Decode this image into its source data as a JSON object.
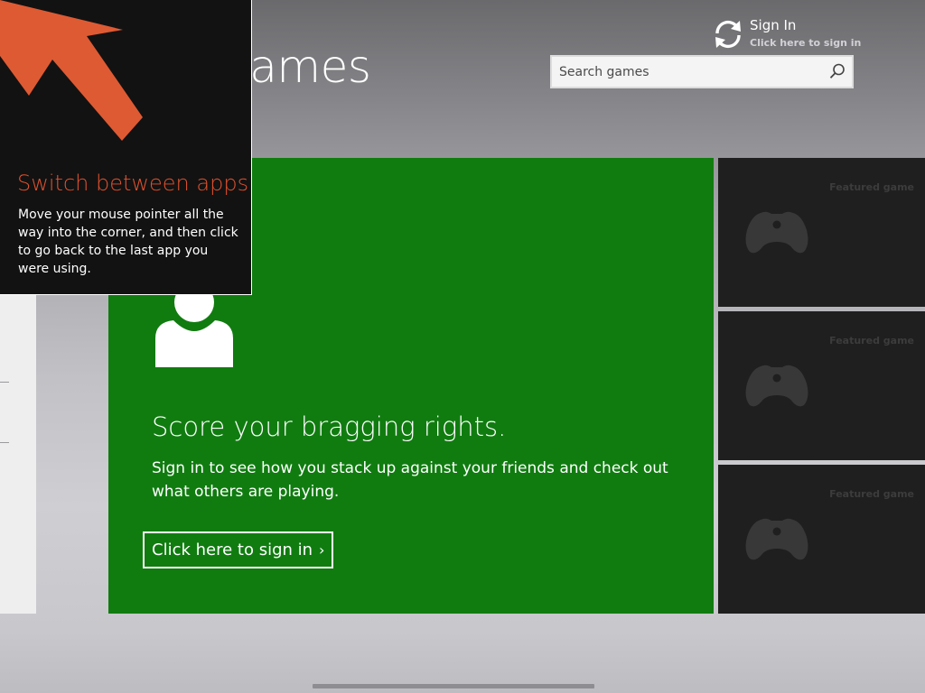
{
  "header": {
    "app_title": "Games",
    "sign_in": {
      "title": "Sign In",
      "subtitle": "Click here to sign in",
      "icon": "sync-icon"
    },
    "search": {
      "placeholder": "Search games",
      "value": "",
      "icon": "search-icon"
    }
  },
  "hero": {
    "icon": "person-icon",
    "headline": "Score your bragging rights.",
    "body": "Sign in to see how you stack up against your friends and check out what others are playing.",
    "button_label": "Click here to sign in",
    "button_chevron": "›",
    "background_color": "#107c10"
  },
  "featured": {
    "tiles": [
      {
        "label": "Featured game",
        "icon": "controller-icon"
      },
      {
        "label": "Featured game",
        "icon": "controller-icon"
      },
      {
        "label": "Featured game",
        "icon": "controller-icon"
      }
    ],
    "tile_color": "#1f1f1f"
  },
  "switch_apps_tip": {
    "title": "Switch between apps",
    "body": "Move your mouse pointer all the way into the corner, and then click to go back to the last app you were using.",
    "icon": "corner-arrow-icon",
    "accent_color": "#e0522e"
  }
}
